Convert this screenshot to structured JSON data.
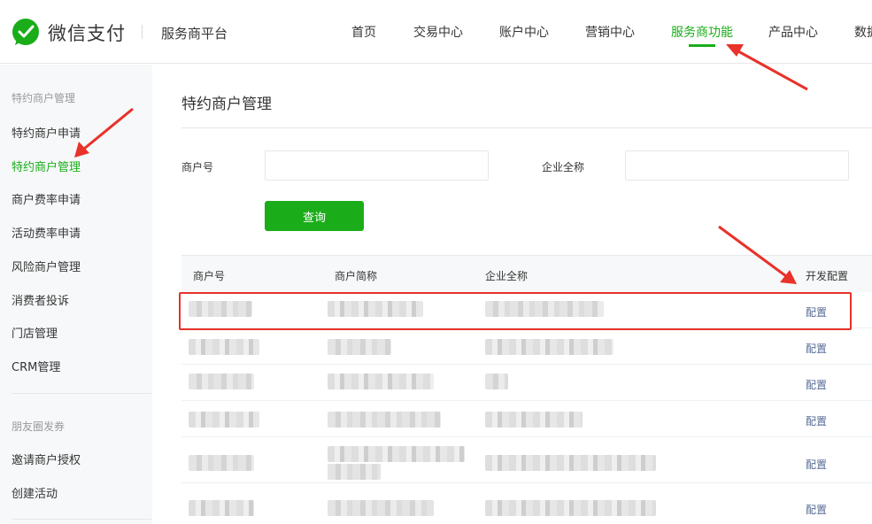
{
  "header": {
    "logo_text": "微信支付",
    "platform_name": "服务商平台",
    "nav": [
      {
        "label": "首页"
      },
      {
        "label": "交易中心"
      },
      {
        "label": "账户中心"
      },
      {
        "label": "营销中心"
      },
      {
        "label": "服务商功能",
        "active": true
      },
      {
        "label": "产品中心"
      },
      {
        "label": "数据"
      }
    ]
  },
  "sidebar": {
    "groups": [
      {
        "title": "特约商户管理",
        "items": [
          "特约商户申请",
          "特约商户管理",
          "商户费率申请",
          "活动费率申请",
          "风险商户管理",
          "消费者投诉",
          "门店管理",
          "CRM管理"
        ]
      },
      {
        "title": "朋友圈发券",
        "items": [
          "邀请商户授权",
          "创建活动"
        ]
      }
    ],
    "active_item": "特约商户管理"
  },
  "main": {
    "title": "特约商户管理",
    "form": {
      "merchant_no_label": "商户号",
      "merchant_no_value": "",
      "company_label": "企业全称",
      "company_value": "",
      "query_button": "查询"
    },
    "table": {
      "columns": [
        "商户号",
        "商户简称",
        "企业全称",
        "开发配置"
      ],
      "rows": [
        {
          "config": "配置"
        },
        {
          "config": "配置"
        },
        {
          "config": "配置"
        },
        {
          "config": "配置"
        },
        {
          "config": "配置"
        },
        {
          "config": "配置"
        }
      ]
    }
  },
  "colors": {
    "brand_green": "#1aad19",
    "link_blue": "#576b95",
    "annotation_red": "#e8322a"
  },
  "icons": {
    "logo": "wechat-pay-logo-icon"
  }
}
